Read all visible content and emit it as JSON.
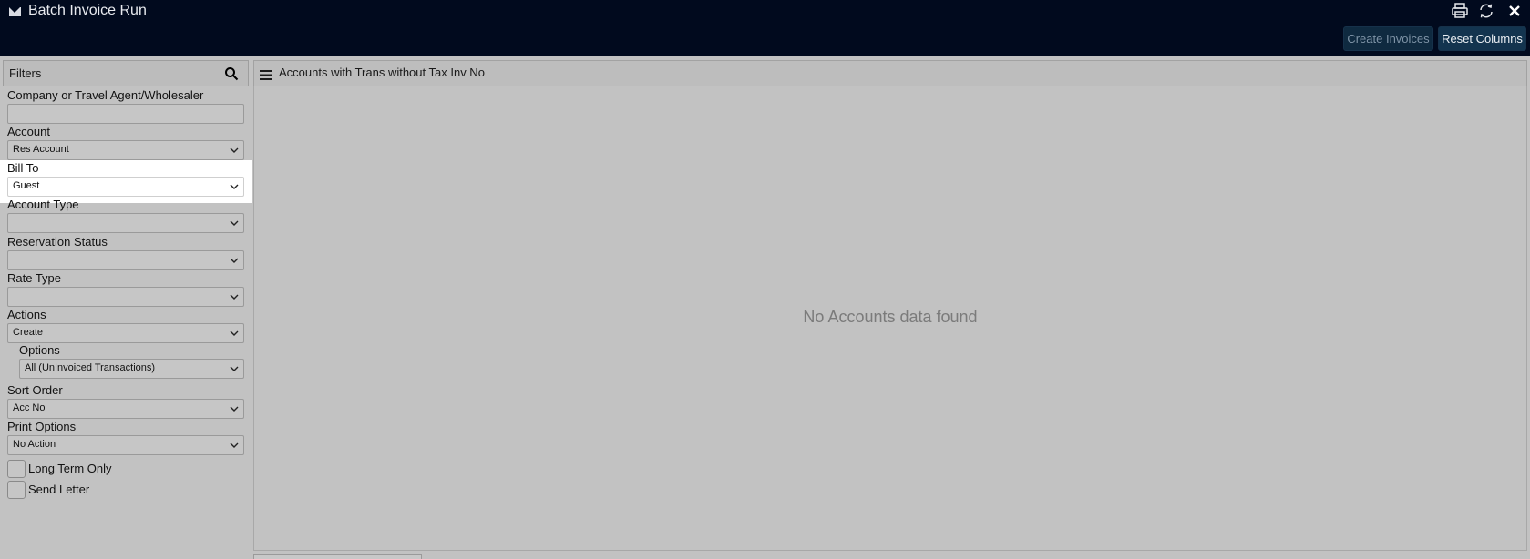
{
  "window": {
    "title": "Batch Invoice Run",
    "title_icon": "envelope-icon",
    "toolbar_icons": [
      "print-icon",
      "refresh-icon",
      "close-icon"
    ]
  },
  "toolbar": {
    "create_invoices_label": "Create Invoices",
    "reset_columns_label": "Reset Columns"
  },
  "filters": {
    "header": "Filters",
    "company_label": "Company or Travel Agent/Wholesaler",
    "company_value": "",
    "account_label": "Account",
    "account_value": "Res Account",
    "bill_to_label": "Bill To",
    "bill_to_value": "Guest",
    "account_type_label": "Account Type",
    "account_type_value": "",
    "reservation_status_label": "Reservation Status",
    "reservation_status_value": "",
    "rate_type_label": "Rate Type",
    "rate_type_value": "",
    "actions_label": "Actions",
    "actions_value": "Create",
    "options_label": "Options",
    "options_value": "All (UnInvoiced Transactions)",
    "sort_order_label": "Sort Order",
    "sort_order_value": "Acc No",
    "print_options_label": "Print Options",
    "print_options_value": "No Action",
    "long_term_only_label": "Long Term Only",
    "long_term_only_checked": false,
    "send_letter_label": "Send Letter",
    "send_letter_checked": false
  },
  "main": {
    "header": "Accounts with Trans without Tax Inv No",
    "empty_message": "No Accounts data found"
  },
  "colors": {
    "titlebar": "#010a1e",
    "panel_background": "#c2c2c2",
    "button_primary": "#13344f"
  }
}
